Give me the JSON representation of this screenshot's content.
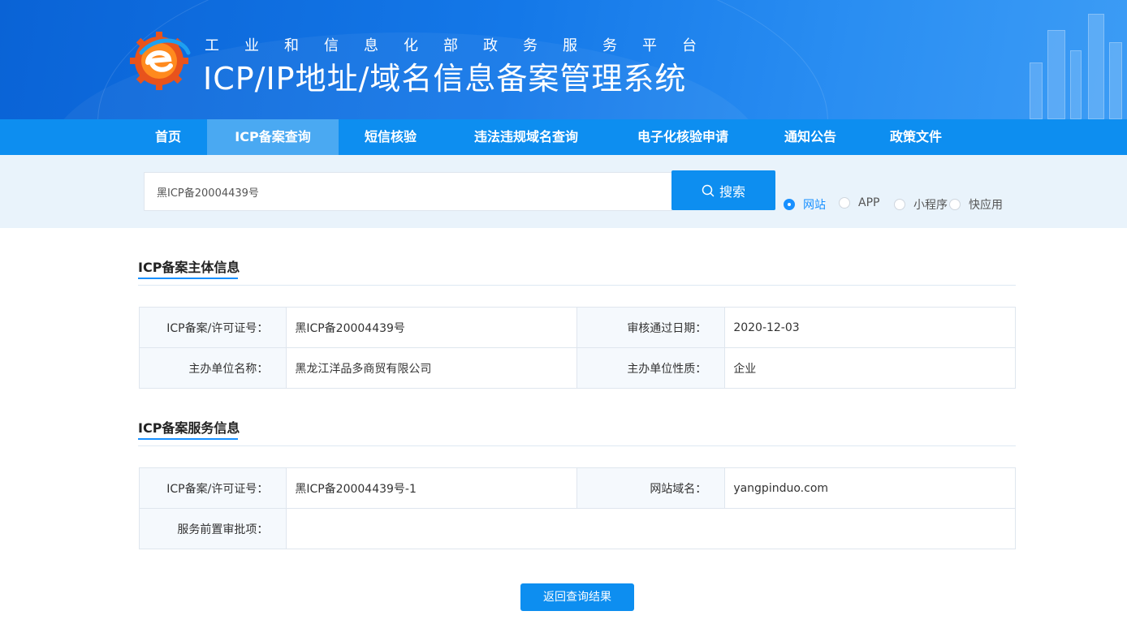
{
  "header": {
    "subtitle": "工业和信息化部政务服务平台",
    "title": "ICP/IP地址/域名信息备案管理系统"
  },
  "nav": {
    "items": [
      {
        "label": "首页"
      },
      {
        "label": "ICP备案查询",
        "active": true
      },
      {
        "label": "短信核验"
      },
      {
        "label": "违法违规域名查询"
      },
      {
        "label": "电子化核验申请"
      },
      {
        "label": "通知公告"
      },
      {
        "label": "政策文件"
      }
    ]
  },
  "search": {
    "value": "黑ICP备20004439号",
    "button_label": "搜索",
    "types": [
      {
        "label": "网站",
        "checked": true
      },
      {
        "label": "APP",
        "checked": false
      },
      {
        "label": "小程序",
        "checked": false
      },
      {
        "label": "快应用",
        "checked": false
      }
    ]
  },
  "subject": {
    "title": "ICP备案主体信息",
    "rows": [
      {
        "k1": "ICP备案/许可证号：",
        "v1": "黑ICP备20004439号",
        "k2": "审核通过日期：",
        "v2": "2020-12-03"
      },
      {
        "k1": "主办单位名称：",
        "v1": "黑龙江洋品多商贸有限公司",
        "k2": "主办单位性质：",
        "v2": "企业"
      }
    ]
  },
  "service": {
    "title": "ICP备案服务信息",
    "rows": [
      {
        "k1": "ICP备案/许可证号：",
        "v1": "黑ICP备20004439号-1",
        "k2": "网站域名：",
        "v2": "yangpinduo.com"
      },
      {
        "k1": "服务前置审批项：",
        "v1": ""
      }
    ]
  },
  "back_button": "返回查询结果",
  "colors": {
    "primary": "#0d8ef0",
    "nav_active": "#4aa9f2",
    "band": "#e9f3fb"
  }
}
